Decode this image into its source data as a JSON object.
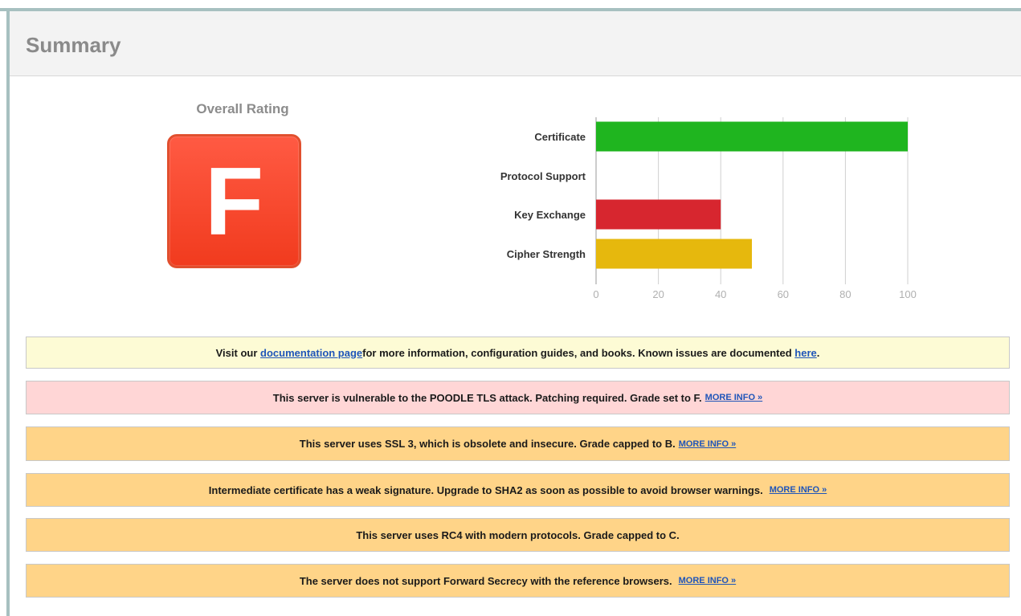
{
  "summary": {
    "title": "Summary",
    "overall_rating_label": "Overall Rating",
    "grade": "F"
  },
  "chart_data": {
    "type": "bar",
    "orientation": "horizontal",
    "categories": [
      "Certificate",
      "Protocol Support",
      "Key Exchange",
      "Cipher Strength"
    ],
    "values": [
      100,
      0,
      40,
      50
    ],
    "bar_colors": [
      "#1fb51f",
      "#ffffff",
      "#d7262f",
      "#e6b80d"
    ],
    "xlim": [
      0,
      100
    ],
    "xticks": [
      0,
      20,
      40,
      60,
      80,
      100
    ],
    "grid": true
  },
  "notices": [
    {
      "color": "yellow",
      "before": "Visit our ",
      "link1": "documentation page",
      "middle": " for more information, configuration guides, and books. Known issues are documented ",
      "link2": "here",
      "after": "."
    },
    {
      "color": "red",
      "text": "This server is vulnerable to the POODLE TLS attack. Patching required. Grade set to F.",
      "more": "MORE INFO »"
    },
    {
      "color": "orange",
      "text": "This server uses SSL 3, which is obsolete and insecure. Grade capped to B.",
      "more": "MORE INFO »"
    },
    {
      "color": "orange",
      "text": "Intermediate certificate has a weak signature. Upgrade to SHA2 as soon as possible to avoid browser warnings.",
      "more": "MORE INFO »"
    },
    {
      "color": "orange",
      "text": "This server uses RC4 with modern protocols. Grade capped to C."
    },
    {
      "color": "orange",
      "text": "The server does not support Forward Secrecy with the reference browsers.",
      "more": "MORE INFO »"
    }
  ]
}
